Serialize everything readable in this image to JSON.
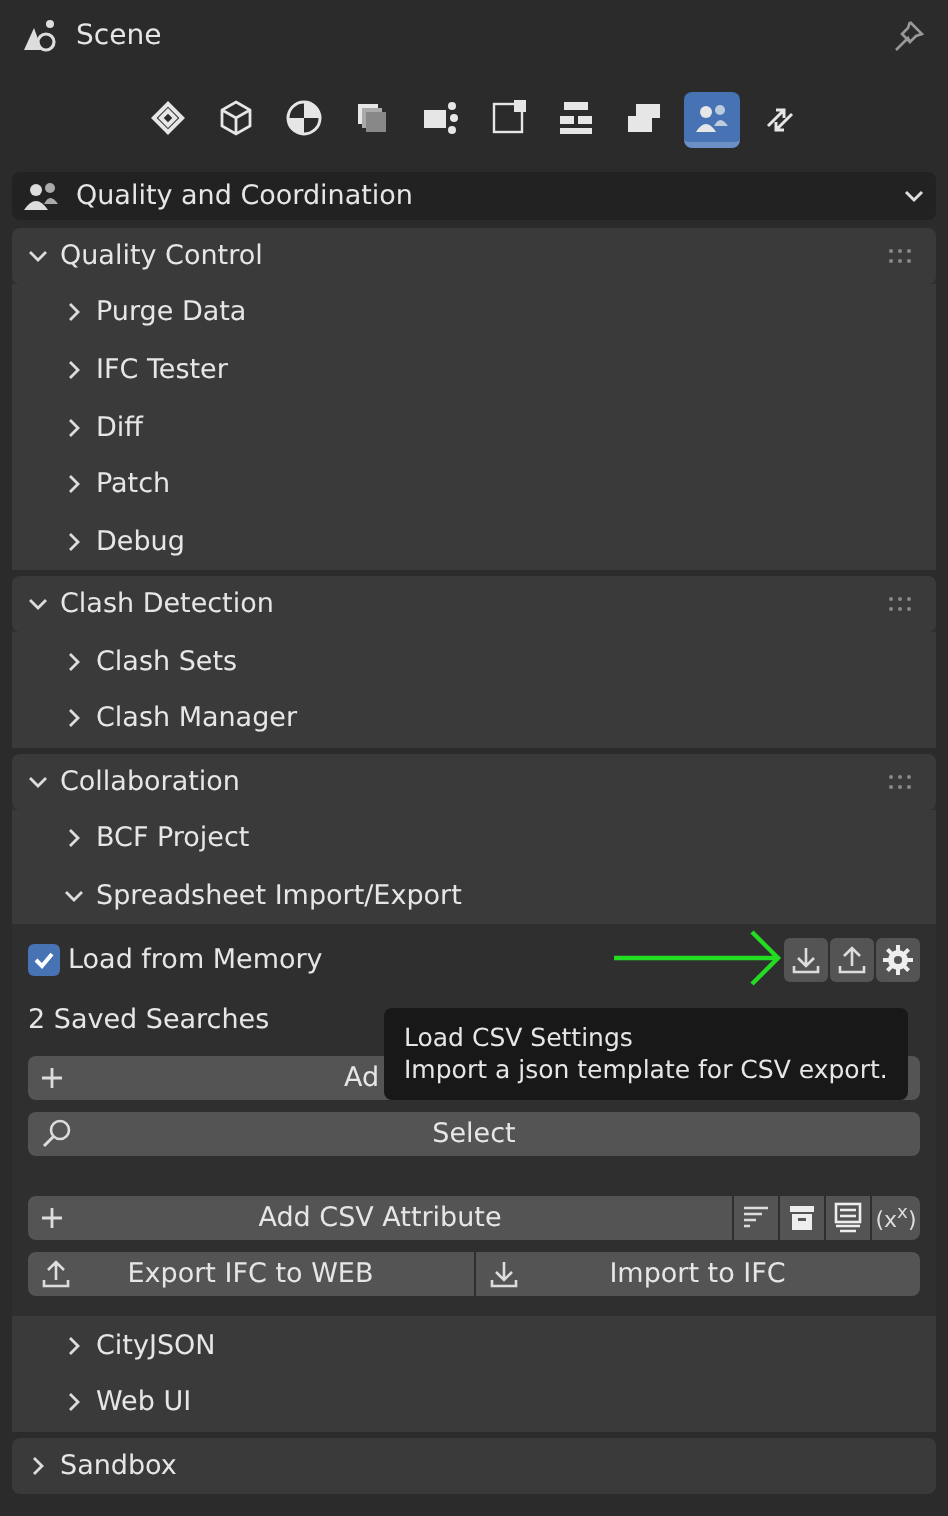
{
  "header": {
    "title": "Scene"
  },
  "tabs": [
    {
      "selected": false
    },
    {
      "selected": false
    },
    {
      "selected": false
    },
    {
      "selected": false
    },
    {
      "selected": false
    },
    {
      "selected": false
    },
    {
      "selected": false
    },
    {
      "selected": false
    },
    {
      "selected": true
    },
    {
      "selected": false
    }
  ],
  "context_dropdown": {
    "value": "Quality and Coordination"
  },
  "panels": [
    {
      "title": "Quality Control",
      "expanded": true,
      "children": [
        {
          "title": "Purge Data",
          "expanded": false
        },
        {
          "title": "IFC Tester",
          "expanded": false
        },
        {
          "title": "Diff",
          "expanded": false
        },
        {
          "title": "Patch",
          "expanded": false
        },
        {
          "title": "Debug",
          "expanded": false
        }
      ]
    },
    {
      "title": "Clash Detection",
      "expanded": true,
      "children": [
        {
          "title": "Clash Sets",
          "expanded": false
        },
        {
          "title": "Clash Manager",
          "expanded": false
        }
      ]
    },
    {
      "title": "Collaboration",
      "expanded": true,
      "children": [
        {
          "title": "BCF Project",
          "expanded": false
        },
        {
          "title": "Spreadsheet Import/Export",
          "expanded": true,
          "kind": "spreadsheet"
        },
        {
          "title": "CityJSON",
          "expanded": false
        },
        {
          "title": "Web UI",
          "expanded": false
        }
      ]
    },
    {
      "title": "Sandbox",
      "expanded": false
    }
  ],
  "spreadsheet": {
    "load_from_memory": {
      "label": "Load from Memory",
      "checked": true
    },
    "saved_searches": "2 Saved Searches",
    "add_button": "Ad",
    "select_button": "Select",
    "add_attribute_button": "Add CSV Attribute",
    "variable_button": "(x$^{x}$)",
    "export_button": "Export IFC to WEB",
    "import_button": "Import to IFC"
  },
  "tooltip": {
    "title": "Load CSV Settings",
    "description": "Import a json template for CSV export."
  }
}
